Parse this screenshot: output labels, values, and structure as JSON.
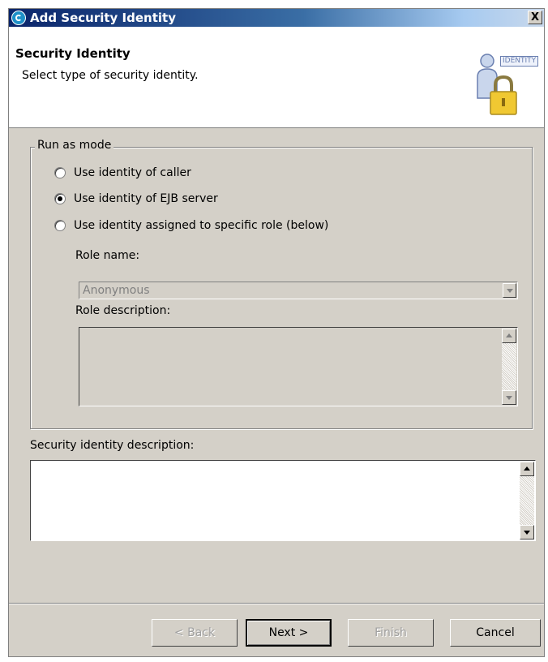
{
  "window": {
    "title": "Add Security Identity",
    "close_glyph": "X"
  },
  "banner": {
    "title": "Security Identity",
    "description": "Select type of security identity.",
    "graphic_text": "IDENTITY",
    "graphic_icon": "user-with-padlock-icon"
  },
  "run_as_mode": {
    "legend": "Run as mode",
    "options": [
      {
        "label": "Use identity of caller",
        "checked": false
      },
      {
        "label": "Use identity of EJB server",
        "checked": true
      },
      {
        "label": "Use identity assigned to specific role (below)",
        "checked": false
      }
    ],
    "role_name_label": "Role name:",
    "role_name_value": "Anonymous",
    "role_description_label": "Role description:",
    "role_description_value": ""
  },
  "security_identity_description": {
    "label": "Security identity description:",
    "value": ""
  },
  "buttons": {
    "back": "< Back",
    "next": "Next >",
    "finish": "Finish",
    "cancel": "Cancel"
  }
}
